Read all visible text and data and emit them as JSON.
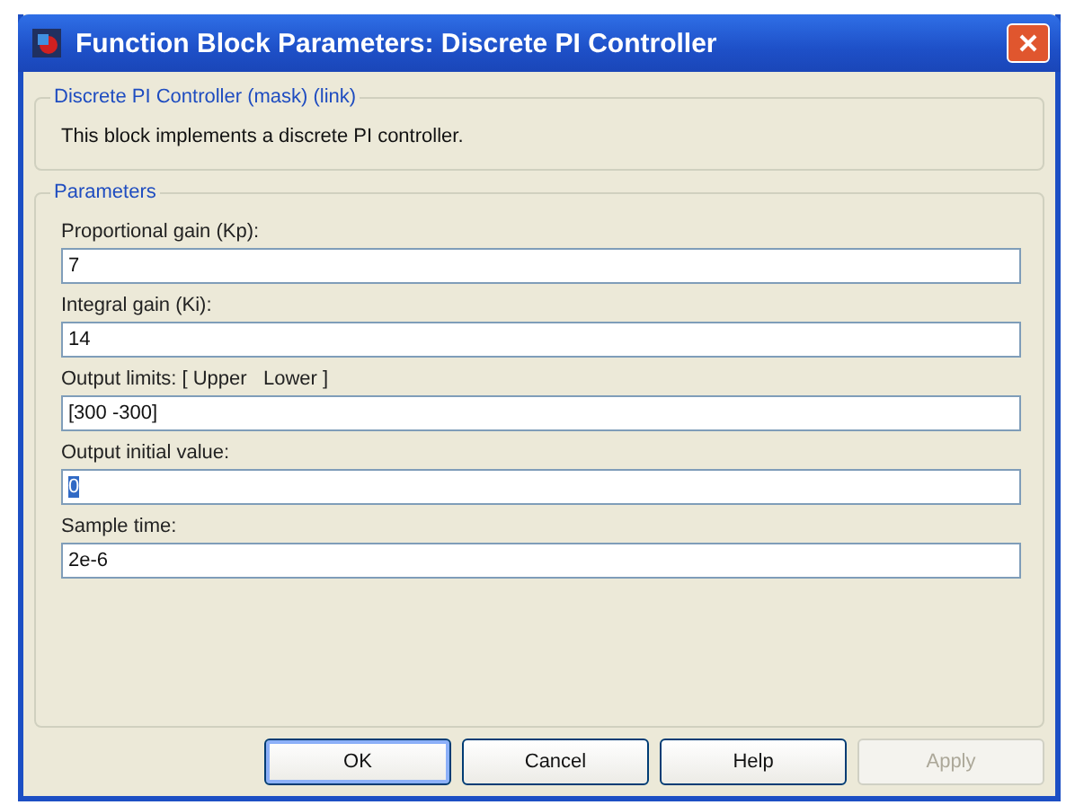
{
  "window": {
    "title": "Function Block Parameters: Discrete PI Controller"
  },
  "description_group": {
    "title": "Discrete PI Controller (mask) (link)",
    "text": "This block implements a discrete PI controller."
  },
  "parameters_group": {
    "title": "Parameters",
    "fields": [
      {
        "label": "Proportional gain (Kp):",
        "value": "7",
        "selected": false
      },
      {
        "label": "Integral gain (Ki):",
        "value": "14",
        "selected": false
      },
      {
        "label": "Output limits: [ Upper   Lower ]",
        "value": "[300 -300]",
        "selected": false
      },
      {
        "label": "Output initial value:",
        "value": "0",
        "selected": true
      },
      {
        "label": "Sample time:",
        "value": "2e-6",
        "selected": false
      }
    ]
  },
  "buttons": [
    {
      "label": "OK",
      "disabled": false,
      "default": true
    },
    {
      "label": "Cancel",
      "disabled": false,
      "default": false
    },
    {
      "label": "Help",
      "disabled": false,
      "default": false
    },
    {
      "label": "Apply",
      "disabled": true,
      "default": false
    }
  ]
}
